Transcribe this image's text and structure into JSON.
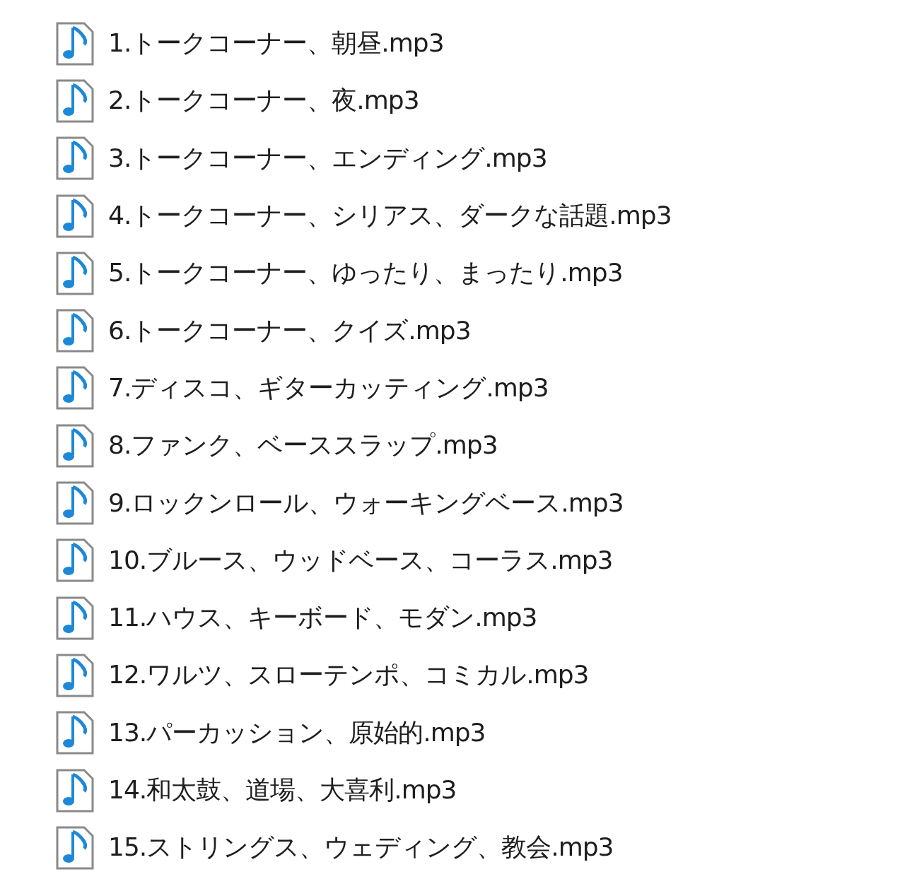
{
  "files": [
    {
      "name": "1.トークコーナー、朝昼.mp3"
    },
    {
      "name": "2.トークコーナー、夜.mp3"
    },
    {
      "name": "3.トークコーナー、エンディング.mp3"
    },
    {
      "name": "4.トークコーナー、シリアス、ダークな話題.mp3"
    },
    {
      "name": "5.トークコーナー、ゆったり、まったり.mp3"
    },
    {
      "name": "6.トークコーナー、クイズ.mp3"
    },
    {
      "name": "7.ディスコ、ギターカッティング.mp3"
    },
    {
      "name": "8.ファンク、ベーススラップ.mp3"
    },
    {
      "name": "9.ロックンロール、ウォーキングベース.mp3"
    },
    {
      "name": "10.ブルース、ウッドベース、コーラス.mp3"
    },
    {
      "name": "11.ハウス、キーボード、モダン.mp3"
    },
    {
      "name": "12.ワルツ、スローテンポ、コミカル.mp3"
    },
    {
      "name": "13.パーカッション、原始的.mp3"
    },
    {
      "name": "14.和太鼓、道場、大喜利.mp3"
    },
    {
      "name": "15.ストリングス、ウェディング、教会.mp3"
    }
  ]
}
